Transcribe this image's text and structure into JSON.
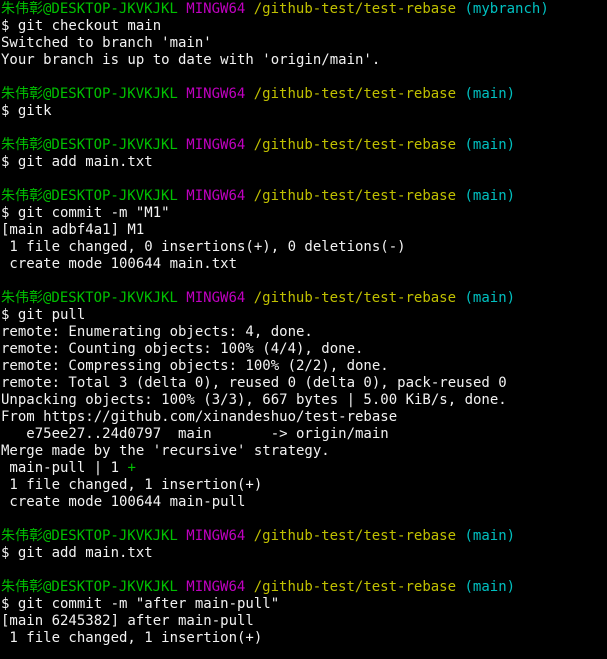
{
  "terminal": {
    "lines": [
      [
        {
          "t": "朱伟彰@DESKTOP-JKVKJKL",
          "c": "green"
        },
        {
          "t": " "
        },
        {
          "t": "MINGW64",
          "c": "magenta"
        },
        {
          "t": " "
        },
        {
          "t": "/github-test/test-rebase",
          "c": "yellow"
        },
        {
          "t": " "
        },
        {
          "t": "(mybranch)",
          "c": "cyan"
        }
      ],
      [
        {
          "t": "$ git checkout main"
        }
      ],
      [
        {
          "t": "Switched to branch 'main'"
        }
      ],
      [
        {
          "t": "Your branch is up to date with 'origin/main'."
        }
      ],
      [],
      [
        {
          "t": "朱伟彰@DESKTOP-JKVKJKL",
          "c": "green"
        },
        {
          "t": " "
        },
        {
          "t": "MINGW64",
          "c": "magenta"
        },
        {
          "t": " "
        },
        {
          "t": "/github-test/test-rebase",
          "c": "yellow"
        },
        {
          "t": " "
        },
        {
          "t": "(main)",
          "c": "cyan"
        }
      ],
      [
        {
          "t": "$ gitk"
        }
      ],
      [],
      [
        {
          "t": "朱伟彰@DESKTOP-JKVKJKL",
          "c": "green"
        },
        {
          "t": " "
        },
        {
          "t": "MINGW64",
          "c": "magenta"
        },
        {
          "t": " "
        },
        {
          "t": "/github-test/test-rebase",
          "c": "yellow"
        },
        {
          "t": " "
        },
        {
          "t": "(main)",
          "c": "cyan"
        }
      ],
      [
        {
          "t": "$ git add main.txt"
        }
      ],
      [],
      [
        {
          "t": "朱伟彰@DESKTOP-JKVKJKL",
          "c": "green"
        },
        {
          "t": " "
        },
        {
          "t": "MINGW64",
          "c": "magenta"
        },
        {
          "t": " "
        },
        {
          "t": "/github-test/test-rebase",
          "c": "yellow"
        },
        {
          "t": " "
        },
        {
          "t": "(main)",
          "c": "cyan"
        }
      ],
      [
        {
          "t": "$ git commit -m \"M1\""
        }
      ],
      [
        {
          "t": "[main adbf4a1] M1"
        }
      ],
      [
        {
          "t": " 1 file changed, 0 insertions(+), 0 deletions(-)"
        }
      ],
      [
        {
          "t": " create mode 100644 main.txt"
        }
      ],
      [],
      [
        {
          "t": "朱伟彰@DESKTOP-JKVKJKL",
          "c": "green"
        },
        {
          "t": " "
        },
        {
          "t": "MINGW64",
          "c": "magenta"
        },
        {
          "t": " "
        },
        {
          "t": "/github-test/test-rebase",
          "c": "yellow"
        },
        {
          "t": " "
        },
        {
          "t": "(main)",
          "c": "cyan"
        }
      ],
      [
        {
          "t": "$ git pull"
        }
      ],
      [
        {
          "t": "remote: Enumerating objects: 4, done."
        }
      ],
      [
        {
          "t": "remote: Counting objects: 100% (4/4), done."
        }
      ],
      [
        {
          "t": "remote: Compressing objects: 100% (2/2), done."
        }
      ],
      [
        {
          "t": "remote: Total 3 (delta 0), reused 0 (delta 0), pack-reused 0"
        }
      ],
      [
        {
          "t": "Unpacking objects: 100% (3/3), 667 bytes | 5.00 KiB/s, done."
        }
      ],
      [
        {
          "t": "From https://github.com/xinandeshuo/test-rebase"
        }
      ],
      [
        {
          "t": "   e75ee27..24d0797  main       -> origin/main"
        }
      ],
      [
        {
          "t": "Merge made by the 'recursive' strategy."
        }
      ],
      [
        {
          "t": " main-pull | 1 "
        },
        {
          "t": "+",
          "c": "green"
        }
      ],
      [
        {
          "t": " 1 file changed, 1 insertion(+)"
        }
      ],
      [
        {
          "t": " create mode 100644 main-pull"
        }
      ],
      [],
      [
        {
          "t": "朱伟彰@DESKTOP-JKVKJKL",
          "c": "green"
        },
        {
          "t": " "
        },
        {
          "t": "MINGW64",
          "c": "magenta"
        },
        {
          "t": " "
        },
        {
          "t": "/github-test/test-rebase",
          "c": "yellow"
        },
        {
          "t": " "
        },
        {
          "t": "(main)",
          "c": "cyan"
        }
      ],
      [
        {
          "t": "$ git add main.txt"
        }
      ],
      [],
      [
        {
          "t": "朱伟彰@DESKTOP-JKVKJKL",
          "c": "green"
        },
        {
          "t": " "
        },
        {
          "t": "MINGW64",
          "c": "magenta"
        },
        {
          "t": " "
        },
        {
          "t": "/github-test/test-rebase",
          "c": "yellow"
        },
        {
          "t": " "
        },
        {
          "t": "(main)",
          "c": "cyan"
        }
      ],
      [
        {
          "t": "$ git commit -m \"after main-pull\""
        }
      ],
      [
        {
          "t": "[main 6245382] after main-pull"
        }
      ],
      [
        {
          "t": " 1 file changed, 1 insertion(+)"
        }
      ]
    ]
  }
}
